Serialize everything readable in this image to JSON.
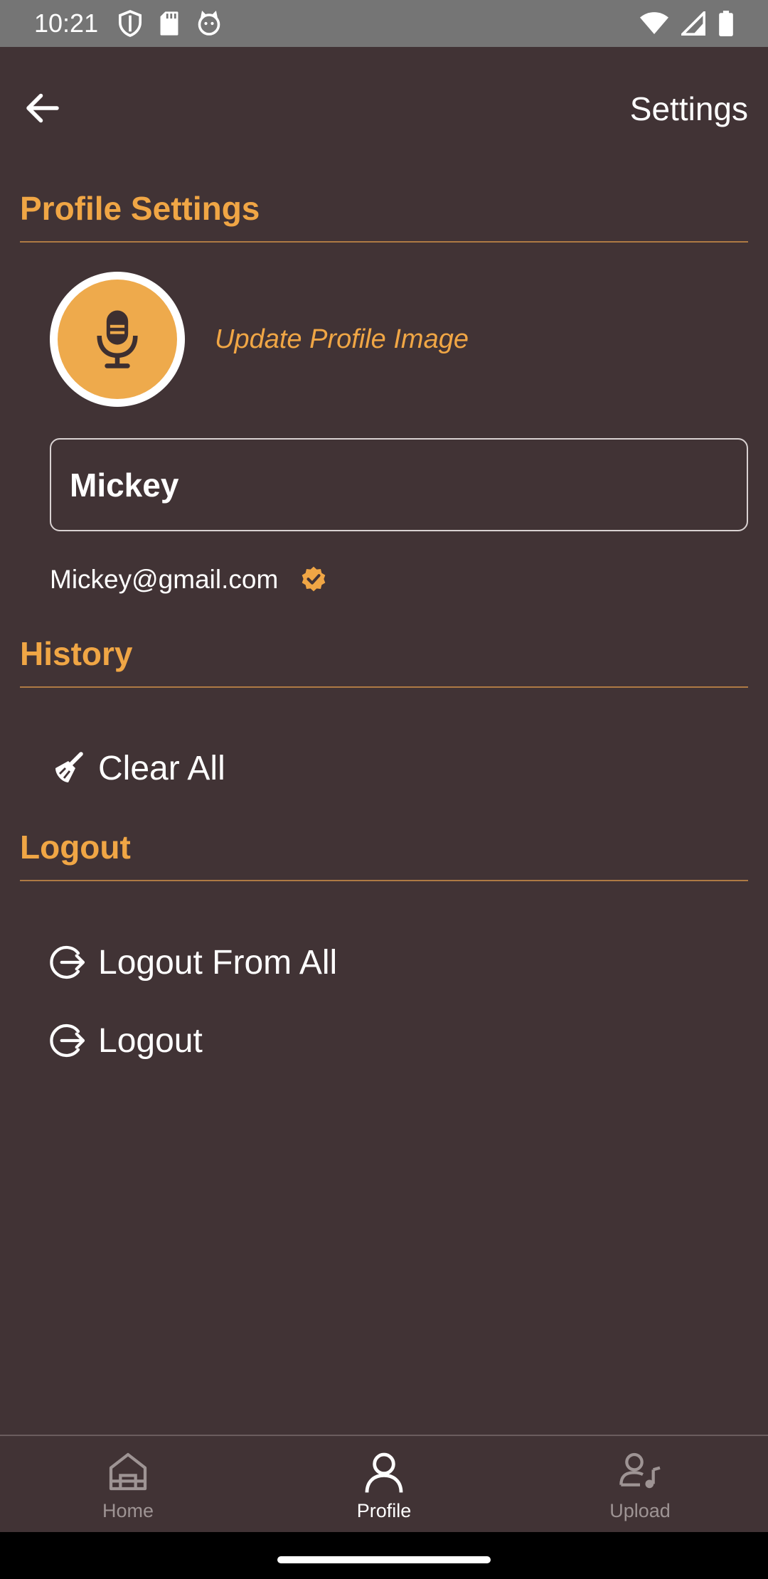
{
  "status_bar": {
    "time": "10:21"
  },
  "app_bar": {
    "title": "Settings"
  },
  "profile_section": {
    "title": "Profile Settings",
    "update_image_label": "Update Profile Image",
    "name_value": "Mickey",
    "email": "Mickey@gmail.com"
  },
  "history_section": {
    "title": "History",
    "clear_all_label": "Clear All"
  },
  "logout_section": {
    "title": "Logout",
    "logout_all_label": "Logout From All",
    "logout_label": "Logout"
  },
  "bottom_nav": {
    "items": [
      {
        "label": "Home",
        "icon": "home-icon",
        "active": false
      },
      {
        "label": "Profile",
        "icon": "person-icon",
        "active": true
      },
      {
        "label": "Upload",
        "icon": "person-music-icon",
        "active": false
      }
    ]
  },
  "colors": {
    "background": "#413335",
    "accent": "#f0a645",
    "status_bar": "#757575"
  }
}
